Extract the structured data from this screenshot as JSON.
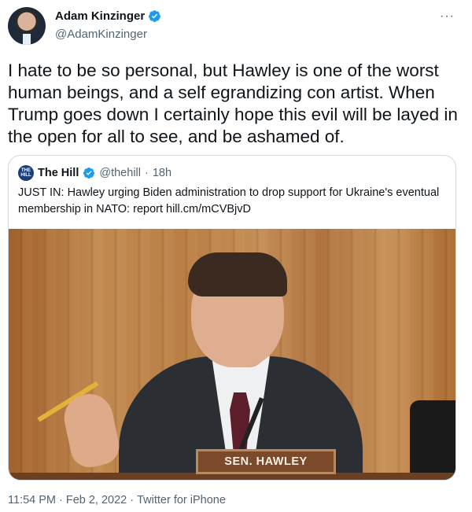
{
  "author": {
    "display_name": "Adam Kinzinger",
    "handle": "@AdamKinzinger",
    "verified": true,
    "more_icon": "···"
  },
  "tweet": {
    "text": "I hate to be so personal, but Hawley is one of the worst human beings, and a self egrandizing con artist.  When Trump goes down I certainly hope this evil will be layed in the open for all to see, and be ashamed of."
  },
  "quoted_tweet": {
    "avatar_text": "THE HILL",
    "display_name": "The Hill",
    "handle": "@thehill",
    "separator": "·",
    "age": "18h",
    "text": "JUST IN: Hawley urging Biden administration to drop support for Ukraine's eventual membership in NATO: report hill.cm/mCVBjvD",
    "image": {
      "nameplate": "SEN. HAWLEY"
    }
  },
  "footer": {
    "time": "11:54 PM",
    "sep1": "·",
    "date": "Feb 2, 2022",
    "sep2": "·",
    "source": "Twitter for iPhone"
  },
  "colors": {
    "verified_blue": "#1d9bf0",
    "text_primary": "#0f1419",
    "text_secondary": "#536471",
    "border": "#cfd9de"
  }
}
